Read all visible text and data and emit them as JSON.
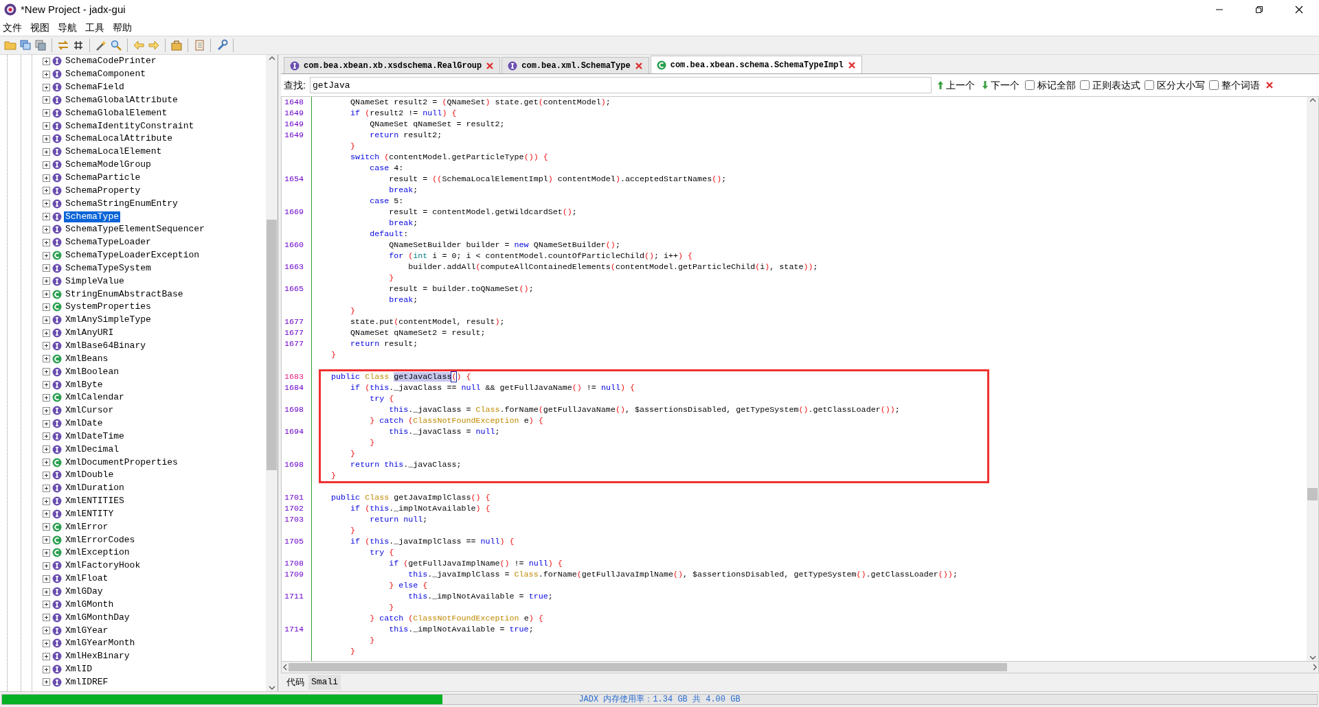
{
  "window": {
    "title": "*New Project - jadx-gui"
  },
  "menu": [
    "文件",
    "视图",
    "导航",
    "工具",
    "帮助"
  ],
  "tree": {
    "items": [
      {
        "label": "SchemaCodePrinter",
        "kind": "interface",
        "selected": false
      },
      {
        "label": "SchemaComponent",
        "kind": "interface",
        "selected": false
      },
      {
        "label": "SchemaField",
        "kind": "interface",
        "selected": false
      },
      {
        "label": "SchemaGlobalAttribute",
        "kind": "interface",
        "selected": false
      },
      {
        "label": "SchemaGlobalElement",
        "kind": "interface",
        "selected": false
      },
      {
        "label": "SchemaIdentityConstraint",
        "kind": "interface",
        "selected": false
      },
      {
        "label": "SchemaLocalAttribute",
        "kind": "interface",
        "selected": false
      },
      {
        "label": "SchemaLocalElement",
        "kind": "interface",
        "selected": false
      },
      {
        "label": "SchemaModelGroup",
        "kind": "interface",
        "selected": false
      },
      {
        "label": "SchemaParticle",
        "kind": "interface",
        "selected": false
      },
      {
        "label": "SchemaProperty",
        "kind": "interface",
        "selected": false
      },
      {
        "label": "SchemaStringEnumEntry",
        "kind": "interface",
        "selected": false
      },
      {
        "label": "SchemaType",
        "kind": "interface",
        "selected": true
      },
      {
        "label": "SchemaTypeElementSequencer",
        "kind": "interface",
        "selected": false
      },
      {
        "label": "SchemaTypeLoader",
        "kind": "interface",
        "selected": false
      },
      {
        "label": "SchemaTypeLoaderException",
        "kind": "class",
        "selected": false
      },
      {
        "label": "SchemaTypeSystem",
        "kind": "interface",
        "selected": false
      },
      {
        "label": "SimpleValue",
        "kind": "interface",
        "selected": false
      },
      {
        "label": "StringEnumAbstractBase",
        "kind": "class",
        "selected": false
      },
      {
        "label": "SystemProperties",
        "kind": "class",
        "selected": false
      },
      {
        "label": "XmlAnySimpleType",
        "kind": "interface",
        "selected": false
      },
      {
        "label": "XmlAnyURI",
        "kind": "interface",
        "selected": false
      },
      {
        "label": "XmlBase64Binary",
        "kind": "interface",
        "selected": false
      },
      {
        "label": "XmlBeans",
        "kind": "class",
        "selected": false
      },
      {
        "label": "XmlBoolean",
        "kind": "interface",
        "selected": false
      },
      {
        "label": "XmlByte",
        "kind": "interface",
        "selected": false
      },
      {
        "label": "XmlCalendar",
        "kind": "class",
        "selected": false
      },
      {
        "label": "XmlCursor",
        "kind": "interface",
        "selected": false
      },
      {
        "label": "XmlDate",
        "kind": "interface",
        "selected": false
      },
      {
        "label": "XmlDateTime",
        "kind": "interface",
        "selected": false
      },
      {
        "label": "XmlDecimal",
        "kind": "interface",
        "selected": false
      },
      {
        "label": "XmlDocumentProperties",
        "kind": "class",
        "selected": false
      },
      {
        "label": "XmlDouble",
        "kind": "interface",
        "selected": false
      },
      {
        "label": "XmlDuration",
        "kind": "interface",
        "selected": false
      },
      {
        "label": "XmlENTITIES",
        "kind": "interface",
        "selected": false
      },
      {
        "label": "XmlENTITY",
        "kind": "interface",
        "selected": false
      },
      {
        "label": "XmlError",
        "kind": "class",
        "selected": false
      },
      {
        "label": "XmlErrorCodes",
        "kind": "class",
        "selected": false
      },
      {
        "label": "XmlException",
        "kind": "class",
        "selected": false
      },
      {
        "label": "XmlFactoryHook",
        "kind": "interface",
        "selected": false
      },
      {
        "label": "XmlFloat",
        "kind": "interface",
        "selected": false
      },
      {
        "label": "XmlGDay",
        "kind": "interface",
        "selected": false
      },
      {
        "label": "XmlGMonth",
        "kind": "interface",
        "selected": false
      },
      {
        "label": "XmlGMonthDay",
        "kind": "interface",
        "selected": false
      },
      {
        "label": "XmlGYear",
        "kind": "interface",
        "selected": false
      },
      {
        "label": "XmlGYearMonth",
        "kind": "interface",
        "selected": false
      },
      {
        "label": "XmlHexBinary",
        "kind": "interface",
        "selected": false
      },
      {
        "label": "XmlID",
        "kind": "interface",
        "selected": false
      },
      {
        "label": "XmlIDREF",
        "kind": "interface",
        "selected": false
      }
    ]
  },
  "tabs": [
    {
      "label": "com.bea.xbean.xb.xsdschema.RealGroup",
      "kind": "interface",
      "selected": false
    },
    {
      "label": "com.bea.xml.SchemaType",
      "kind": "interface",
      "selected": false
    },
    {
      "label": "com.bea.xbean.schema.SchemaTypeImpl",
      "kind": "class",
      "selected": true
    }
  ],
  "search": {
    "label": "查找:",
    "value": "getJava",
    "prev": "上一个",
    "next": "下一个",
    "options": [
      {
        "label": "标记全部",
        "checked": false
      },
      {
        "label": "正则表达式",
        "checked": false
      },
      {
        "label": "区分大小写",
        "checked": false
      },
      {
        "label": "整个词语",
        "checked": false
      }
    ]
  },
  "code": {
    "lines": [
      {
        "kind": "code",
        "number": "1648",
        "current": false,
        "in_callout": false,
        "tokens": [
          {
            "text": "        QNameSet result2 = ",
            "kind": "plain"
          },
          {
            "text": "(",
            "kind": "brace"
          },
          {
            "text": "QNameSet",
            "kind": "plain"
          },
          {
            "text": ")",
            "kind": "brace"
          },
          {
            "text": " state.get",
            "kind": "plain"
          },
          {
            "text": "(",
            "kind": "brace"
          },
          {
            "text": "contentModel",
            "kind": "plain"
          },
          {
            "text": ")",
            "kind": "brace"
          },
          {
            "text": ";",
            "kind": "plain"
          }
        ]
      },
      {
        "kind": "code",
        "number": "1649",
        "current": false,
        "in_callout": false,
        "tokens": [
          {
            "text": "        if",
            "kind": "keyword"
          },
          {
            "text": " (",
            "kind": "brace"
          },
          {
            "text": "result2 != ",
            "kind": "plain"
          },
          {
            "text": "null",
            "kind": "keyword"
          },
          {
            "text": ") {",
            "kind": "brace"
          }
        ]
      },
      {
        "kind": "code",
        "number": "1649",
        "current": false,
        "in_callout": false,
        "tokens": [
          {
            "text": "            QNameSet qNameSet = result2;",
            "kind": "plain"
          }
        ]
      },
      {
        "kind": "code",
        "number": "1649",
        "current": false,
        "in_callout": false,
        "tokens": [
          {
            "text": "            return",
            "kind": "keyword"
          },
          {
            "text": " result2;",
            "kind": "plain"
          }
        ]
      },
      {
        "kind": "code",
        "in_callout": false,
        "tokens": [
          {
            "text": "        }",
            "kind": "brace"
          }
        ]
      },
      {
        "kind": "code",
        "in_callout": false,
        "tokens": [
          {
            "text": "        switch",
            "kind": "keyword"
          },
          {
            "text": " (",
            "kind": "brace"
          },
          {
            "text": "contentModel.getParticleType",
            "kind": "plain"
          },
          {
            "text": "()) {",
            "kind": "brace"
          }
        ]
      },
      {
        "kind": "code",
        "in_callout": false,
        "tokens": [
          {
            "text": "            case",
            "kind": "keyword"
          },
          {
            "text": " 4:",
            "kind": "plain"
          }
        ]
      },
      {
        "kind": "code",
        "number": "1654",
        "current": false,
        "in_callout": false,
        "tokens": [
          {
            "text": "                result = ",
            "kind": "plain"
          },
          {
            "text": "((",
            "kind": "brace"
          },
          {
            "text": "SchemaLocalElementImpl",
            "kind": "plain"
          },
          {
            "text": ")",
            "kind": "brace"
          },
          {
            "text": " contentModel",
            "kind": "plain"
          },
          {
            "text": ")",
            "kind": "brace"
          },
          {
            "text": ".acceptedStartNames",
            "kind": "plain"
          },
          {
            "text": "()",
            "kind": "brace"
          },
          {
            "text": ";",
            "kind": "plain"
          }
        ]
      },
      {
        "kind": "code",
        "in_callout": false,
        "tokens": [
          {
            "text": "                break",
            "kind": "keyword"
          },
          {
            "text": ";",
            "kind": "plain"
          }
        ]
      },
      {
        "kind": "code",
        "in_callout": false,
        "tokens": [
          {
            "text": "            case",
            "kind": "keyword"
          },
          {
            "text": " 5:",
            "kind": "plain"
          }
        ]
      },
      {
        "kind": "code",
        "number": "1669",
        "current": false,
        "in_callout": false,
        "tokens": [
          {
            "text": "                result = contentModel.getWildcardSet",
            "kind": "plain"
          },
          {
            "text": "()",
            "kind": "brace"
          },
          {
            "text": ";",
            "kind": "plain"
          }
        ]
      },
      {
        "kind": "code",
        "in_callout": false,
        "tokens": [
          {
            "text": "                break",
            "kind": "keyword"
          },
          {
            "text": ";",
            "kind": "plain"
          }
        ]
      },
      {
        "kind": "code",
        "in_callout": false,
        "tokens": [
          {
            "text": "            default",
            "kind": "keyword"
          },
          {
            "text": ":",
            "kind": "plain"
          }
        ]
      },
      {
        "kind": "code",
        "number": "1660",
        "current": false,
        "in_callout": false,
        "tokens": [
          {
            "text": "                QNameSetBuilder builder = ",
            "kind": "plain"
          },
          {
            "text": "new",
            "kind": "keyword"
          },
          {
            "text": " QNameSetBuilder",
            "kind": "plain"
          },
          {
            "text": "()",
            "kind": "brace"
          },
          {
            "text": ";",
            "kind": "plain"
          }
        ]
      },
      {
        "kind": "code",
        "in_callout": false,
        "tokens": [
          {
            "text": "                for",
            "kind": "keyword"
          },
          {
            "text": " (",
            "kind": "brace"
          },
          {
            "text": "int",
            "kind": "prim"
          },
          {
            "text": " i = 0; i < contentModel.countOfParticleChild",
            "kind": "plain"
          },
          {
            "text": "()",
            "kind": "brace"
          },
          {
            "text": "; i++",
            "kind": "plain"
          },
          {
            "text": ") {",
            "kind": "brace"
          }
        ]
      },
      {
        "kind": "code",
        "number": "1663",
        "current": false,
        "in_callout": false,
        "tokens": [
          {
            "text": "                    builder.addAll",
            "kind": "plain"
          },
          {
            "text": "(",
            "kind": "brace"
          },
          {
            "text": "computeAllContainedElements",
            "kind": "plain"
          },
          {
            "text": "(",
            "kind": "brace"
          },
          {
            "text": "contentModel.getParticleChild",
            "kind": "plain"
          },
          {
            "text": "(",
            "kind": "brace"
          },
          {
            "text": "i",
            "kind": "plain"
          },
          {
            "text": ")",
            "kind": "brace"
          },
          {
            "text": ", state",
            "kind": "plain"
          },
          {
            "text": "))",
            "kind": "brace"
          },
          {
            "text": ";",
            "kind": "plain"
          }
        ]
      },
      {
        "kind": "code",
        "in_callout": false,
        "tokens": [
          {
            "text": "                }",
            "kind": "brace"
          }
        ]
      },
      {
        "kind": "code",
        "number": "1665",
        "current": false,
        "in_callout": false,
        "tokens": [
          {
            "text": "                result = builder.toQNameSet",
            "kind": "plain"
          },
          {
            "text": "()",
            "kind": "brace"
          },
          {
            "text": ";",
            "kind": "plain"
          }
        ]
      },
      {
        "kind": "code",
        "in_callout": false,
        "tokens": [
          {
            "text": "                break",
            "kind": "keyword"
          },
          {
            "text": ";",
            "kind": "plain"
          }
        ]
      },
      {
        "kind": "code",
        "in_callout": false,
        "tokens": [
          {
            "text": "        }",
            "kind": "brace"
          }
        ]
      },
      {
        "kind": "code",
        "number": "1677",
        "current": false,
        "in_callout": false,
        "tokens": [
          {
            "text": "        state.put",
            "kind": "plain"
          },
          {
            "text": "(",
            "kind": "brace"
          },
          {
            "text": "contentModel, result",
            "kind": "plain"
          },
          {
            "text": ")",
            "kind": "brace"
          },
          {
            "text": ";",
            "kind": "plain"
          }
        ]
      },
      {
        "kind": "code",
        "number": "1677",
        "current": false,
        "in_callout": false,
        "tokens": [
          {
            "text": "        QNameSet qNameSet2 = result;",
            "kind": "plain"
          }
        ]
      },
      {
        "kind": "code",
        "number": "1677",
        "current": false,
        "in_callout": false,
        "tokens": [
          {
            "text": "        return",
            "kind": "keyword"
          },
          {
            "text": " result;",
            "kind": "plain"
          }
        ]
      },
      {
        "kind": "code",
        "in_callout": false,
        "tokens": [
          {
            "text": "    }",
            "kind": "brace"
          }
        ]
      },
      {
        "kind": "blank"
      },
      {
        "kind": "code",
        "number": "1683",
        "current": true,
        "in_callout": true,
        "tokens": [
          {
            "text": "    public",
            "kind": "keyword"
          },
          {
            "text": " Class ",
            "kind": "type"
          },
          {
            "text": "getJavaClass",
            "kind": "match"
          },
          {
            "text": "(",
            "kind": "caret"
          },
          {
            "text": ") {",
            "kind": "brace"
          }
        ]
      },
      {
        "kind": "code",
        "number": "1684",
        "current": false,
        "in_callout": true,
        "tokens": [
          {
            "text": "        if",
            "kind": "keyword"
          },
          {
            "text": " (",
            "kind": "brace"
          },
          {
            "text": "this",
            "kind": "keyword"
          },
          {
            "text": "._javaClass == ",
            "kind": "plain"
          },
          {
            "text": "null",
            "kind": "keyword"
          },
          {
            "text": " && getFullJavaName",
            "kind": "plain"
          },
          {
            "text": "()",
            "kind": "brace"
          },
          {
            "text": " != ",
            "kind": "plain"
          },
          {
            "text": "null",
            "kind": "keyword"
          },
          {
            "text": ") {",
            "kind": "brace"
          }
        ]
      },
      {
        "kind": "code",
        "in_callout": true,
        "tokens": [
          {
            "text": "            try",
            "kind": "keyword"
          },
          {
            "text": " {",
            "kind": "brace"
          }
        ]
      },
      {
        "kind": "code",
        "number": "1698",
        "current": false,
        "in_callout": true,
        "tokens": [
          {
            "text": "                this",
            "kind": "keyword"
          },
          {
            "text": "._javaClass = ",
            "kind": "plain"
          },
          {
            "text": "Class",
            "kind": "type"
          },
          {
            "text": ".forName",
            "kind": "plain"
          },
          {
            "text": "(",
            "kind": "brace"
          },
          {
            "text": "getFullJavaName",
            "kind": "plain"
          },
          {
            "text": "()",
            "kind": "brace"
          },
          {
            "text": ", $assertionsDisabled, getTypeSystem",
            "kind": "plain"
          },
          {
            "text": "()",
            "kind": "brace"
          },
          {
            "text": ".getClassLoader",
            "kind": "plain"
          },
          {
            "text": "())",
            "kind": "brace"
          },
          {
            "text": ";",
            "kind": "plain"
          }
        ]
      },
      {
        "kind": "code",
        "in_callout": true,
        "tokens": [
          {
            "text": "            }",
            "kind": "brace"
          },
          {
            "text": " catch",
            "kind": "keyword"
          },
          {
            "text": " (",
            "kind": "brace"
          },
          {
            "text": "ClassNotFoundException",
            "kind": "type"
          },
          {
            "text": " e",
            "kind": "plain"
          },
          {
            "text": ") {",
            "kind": "brace"
          }
        ]
      },
      {
        "kind": "code",
        "number": "1694",
        "current": false,
        "in_callout": true,
        "tokens": [
          {
            "text": "                this",
            "kind": "keyword"
          },
          {
            "text": "._javaClass = ",
            "kind": "plain"
          },
          {
            "text": "null",
            "kind": "keyword"
          },
          {
            "text": ";",
            "kind": "plain"
          }
        ]
      },
      {
        "kind": "code",
        "in_callout": true,
        "tokens": [
          {
            "text": "            }",
            "kind": "brace"
          }
        ]
      },
      {
        "kind": "code",
        "in_callout": true,
        "tokens": [
          {
            "text": "        }",
            "kind": "brace"
          }
        ]
      },
      {
        "kind": "code",
        "number": "1698",
        "current": false,
        "in_callout": true,
        "tokens": [
          {
            "text": "        return",
            "kind": "keyword"
          },
          {
            "text": " this",
            "kind": "keyword"
          },
          {
            "text": "._javaClass;",
            "kind": "plain"
          }
        ]
      },
      {
        "kind": "code",
        "in_callout": true,
        "tokens": [
          {
            "text": "    }",
            "kind": "brace"
          }
        ]
      },
      {
        "kind": "blank"
      },
      {
        "kind": "code",
        "number": "1701",
        "current": false,
        "in_callout": false,
        "tokens": [
          {
            "text": "    public",
            "kind": "keyword"
          },
          {
            "text": " Class",
            "kind": "type"
          },
          {
            "text": " getJavaImplClass",
            "kind": "plain"
          },
          {
            "text": "() {",
            "kind": "brace"
          }
        ]
      },
      {
        "kind": "code",
        "number": "1702",
        "current": false,
        "in_callout": false,
        "tokens": [
          {
            "text": "        if",
            "kind": "keyword"
          },
          {
            "text": " (",
            "kind": "brace"
          },
          {
            "text": "this",
            "kind": "keyword"
          },
          {
            "text": "._implNotAvailable",
            "kind": "plain"
          },
          {
            "text": ") {",
            "kind": "brace"
          }
        ]
      },
      {
        "kind": "code",
        "number": "1703",
        "current": false,
        "in_callout": false,
        "tokens": [
          {
            "text": "            return",
            "kind": "keyword"
          },
          {
            "text": " null",
            "kind": "keyword"
          },
          {
            "text": ";",
            "kind": "plain"
          }
        ]
      },
      {
        "kind": "code",
        "in_callout": false,
        "tokens": [
          {
            "text": "        }",
            "kind": "brace"
          }
        ]
      },
      {
        "kind": "code",
        "number": "1705",
        "current": false,
        "in_callout": false,
        "tokens": [
          {
            "text": "        if",
            "kind": "keyword"
          },
          {
            "text": " (",
            "kind": "brace"
          },
          {
            "text": "this",
            "kind": "keyword"
          },
          {
            "text": "._javaImplClass == ",
            "kind": "plain"
          },
          {
            "text": "null",
            "kind": "keyword"
          },
          {
            "text": ") {",
            "kind": "brace"
          }
        ]
      },
      {
        "kind": "code",
        "in_callout": false,
        "tokens": [
          {
            "text": "            try",
            "kind": "keyword"
          },
          {
            "text": " {",
            "kind": "brace"
          }
        ]
      },
      {
        "kind": "code",
        "number": "1708",
        "current": false,
        "in_callout": false,
        "tokens": [
          {
            "text": "                if",
            "kind": "keyword"
          },
          {
            "text": " (",
            "kind": "brace"
          },
          {
            "text": "getFullJavaImplName",
            "kind": "plain"
          },
          {
            "text": "()",
            "kind": "brace"
          },
          {
            "text": " != ",
            "kind": "plain"
          },
          {
            "text": "null",
            "kind": "keyword"
          },
          {
            "text": ") {",
            "kind": "brace"
          }
        ]
      },
      {
        "kind": "code",
        "number": "1709",
        "current": false,
        "in_callout": false,
        "tokens": [
          {
            "text": "                    this",
            "kind": "keyword"
          },
          {
            "text": "._javaImplClass = ",
            "kind": "plain"
          },
          {
            "text": "Class",
            "kind": "type"
          },
          {
            "text": ".forName",
            "kind": "plain"
          },
          {
            "text": "(",
            "kind": "brace"
          },
          {
            "text": "getFullJavaImplName",
            "kind": "plain"
          },
          {
            "text": "()",
            "kind": "brace"
          },
          {
            "text": ", $assertionsDisabled, getTypeSystem",
            "kind": "plain"
          },
          {
            "text": "()",
            "kind": "brace"
          },
          {
            "text": ".getClassLoader",
            "kind": "plain"
          },
          {
            "text": "())",
            "kind": "brace"
          },
          {
            "text": ";",
            "kind": "plain"
          }
        ]
      },
      {
        "kind": "code",
        "in_callout": false,
        "tokens": [
          {
            "text": "                }",
            "kind": "brace"
          },
          {
            "text": " else",
            "kind": "keyword"
          },
          {
            "text": " {",
            "kind": "brace"
          }
        ]
      },
      {
        "kind": "code",
        "number": "1711",
        "current": false,
        "in_callout": false,
        "tokens": [
          {
            "text": "                    this",
            "kind": "keyword"
          },
          {
            "text": "._implNotAvailable = ",
            "kind": "plain"
          },
          {
            "text": "true",
            "kind": "keyword"
          },
          {
            "text": ";",
            "kind": "plain"
          }
        ]
      },
      {
        "kind": "code",
        "in_callout": false,
        "tokens": [
          {
            "text": "                }",
            "kind": "brace"
          }
        ]
      },
      {
        "kind": "code",
        "in_callout": false,
        "tokens": [
          {
            "text": "            }",
            "kind": "brace"
          },
          {
            "text": " catch",
            "kind": "keyword"
          },
          {
            "text": " (",
            "kind": "brace"
          },
          {
            "text": "ClassNotFoundException",
            "kind": "type"
          },
          {
            "text": " e",
            "kind": "plain"
          },
          {
            "text": ") {",
            "kind": "brace"
          }
        ]
      },
      {
        "kind": "code",
        "number": "1714",
        "current": false,
        "in_callout": false,
        "tokens": [
          {
            "text": "                this",
            "kind": "keyword"
          },
          {
            "text": "._implNotAvailable = ",
            "kind": "plain"
          },
          {
            "text": "true",
            "kind": "keyword"
          },
          {
            "text": ";",
            "kind": "plain"
          }
        ]
      },
      {
        "kind": "code",
        "in_callout": false,
        "tokens": [
          {
            "text": "            }",
            "kind": "brace"
          }
        ]
      },
      {
        "kind": "code",
        "in_callout": false,
        "tokens": [
          {
            "text": "        }",
            "kind": "brace"
          }
        ]
      }
    ]
  },
  "bottom_tabs": [
    {
      "label": "代码",
      "selected": true
    },
    {
      "label": "Smali",
      "selected": false
    }
  ],
  "status_bar": {
    "memory": {
      "level": 0.335,
      "text": "JADX 内存使用率：1.34 GB 共 4.00 GB"
    }
  }
}
